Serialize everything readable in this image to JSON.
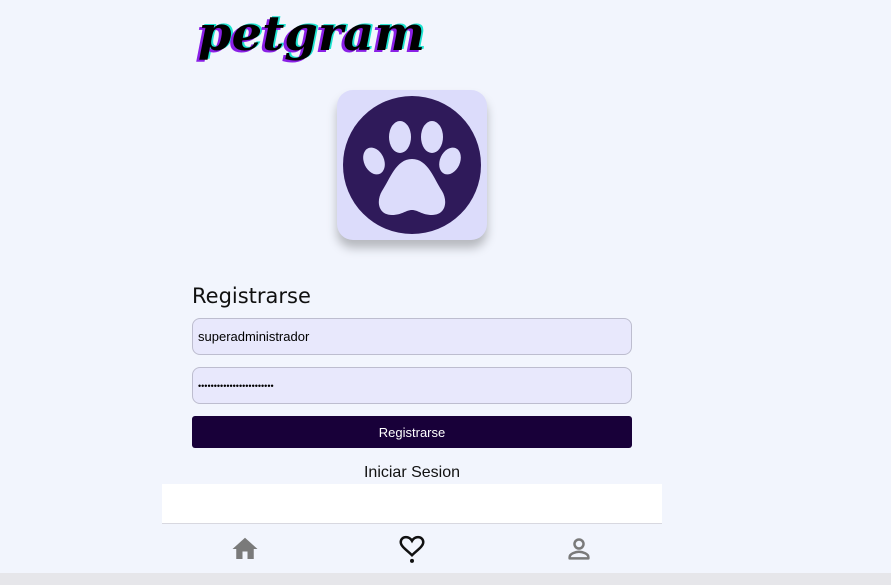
{
  "app": {
    "logo_text": "petgram"
  },
  "avatar": {
    "icon": "paw-icon",
    "card_color": "#dcdcfb",
    "circle_color": "#2f1a5a",
    "paw_color": "#dcdcfb"
  },
  "form": {
    "title": "Registrarse",
    "username_value": "superadministrador",
    "password_value": "••••••••••••••••••••••••",
    "submit_label": "Registrarse",
    "alt_link_label": "Iniciar Sesion"
  },
  "nav": {
    "items": [
      {
        "icon": "home-icon"
      },
      {
        "icon": "heart-icon",
        "active": true
      },
      {
        "icon": "user-icon"
      }
    ]
  },
  "colors": {
    "background": "#f2f5fd",
    "input_bg": "#e8e8fc",
    "button_bg": "#180039",
    "logo_shadow_purple": "#8a1fe6",
    "logo_shadow_teal": "#1de3d0"
  }
}
